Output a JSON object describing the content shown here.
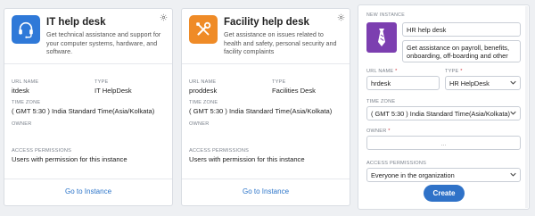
{
  "cards": [
    {
      "title": "IT help desk",
      "description": "Get technical assistance and support for your computer systems, hardware, and software.",
      "url_name_label": "URL NAME",
      "url_name": "itdesk",
      "type_label": "TYPE",
      "type": "IT HelpDesk",
      "timezone_label": "TIME ZONE",
      "timezone": "( GMT 5:30 ) India Standard Time(Asia/Kolkata)",
      "owner_label": "OWNER",
      "owner": "",
      "access_label": "ACCESS PERMISSIONS",
      "access": "Users with permission for this instance",
      "goto": "Go to Instance",
      "icon": "headset-icon",
      "icon_color": "#2f79d8"
    },
    {
      "title": "Facility help desk",
      "description": "Get assistance on issues related to health and safety, personal security and facility complaints",
      "url_name_label": "URL NAME",
      "url_name": "proddesk",
      "type_label": "TYPE",
      "type": "Facilities Desk",
      "timezone_label": "TIME ZONE",
      "timezone": "( GMT 5:30 ) India Standard Time(Asia/Kolkata)",
      "owner_label": "OWNER",
      "owner": "",
      "access_label": "ACCESS PERMISSIONS",
      "access": "Users with permission for this instance",
      "goto": "Go to Instance",
      "icon": "tools-icon",
      "icon_color": "#ef8b27"
    }
  ],
  "new_instance": {
    "heading": "NEW INSTANCE",
    "icon": "tie-icon",
    "icon_color": "#7c3fb0",
    "name_value": "HR help desk",
    "description_value": "Get assistance on payroll, benefits, onboarding, off-boarding and other",
    "url_name_label": "URL NAME",
    "url_name_value": "hrdesk",
    "type_label": "TYPE",
    "type_value": "HR HelpDesk",
    "timezone_label": "TIME ZONE",
    "timezone_value": "( GMT 5:30 ) India Standard Time(Asia/Kolkata)",
    "owner_label": "OWNER",
    "owner_placeholder": "...",
    "access_label": "ACCESS PERMISSIONS",
    "access_value": "Everyone in the organization",
    "required_mark": "*",
    "create_label": "Create",
    "accent_color": "#2f72c8"
  }
}
